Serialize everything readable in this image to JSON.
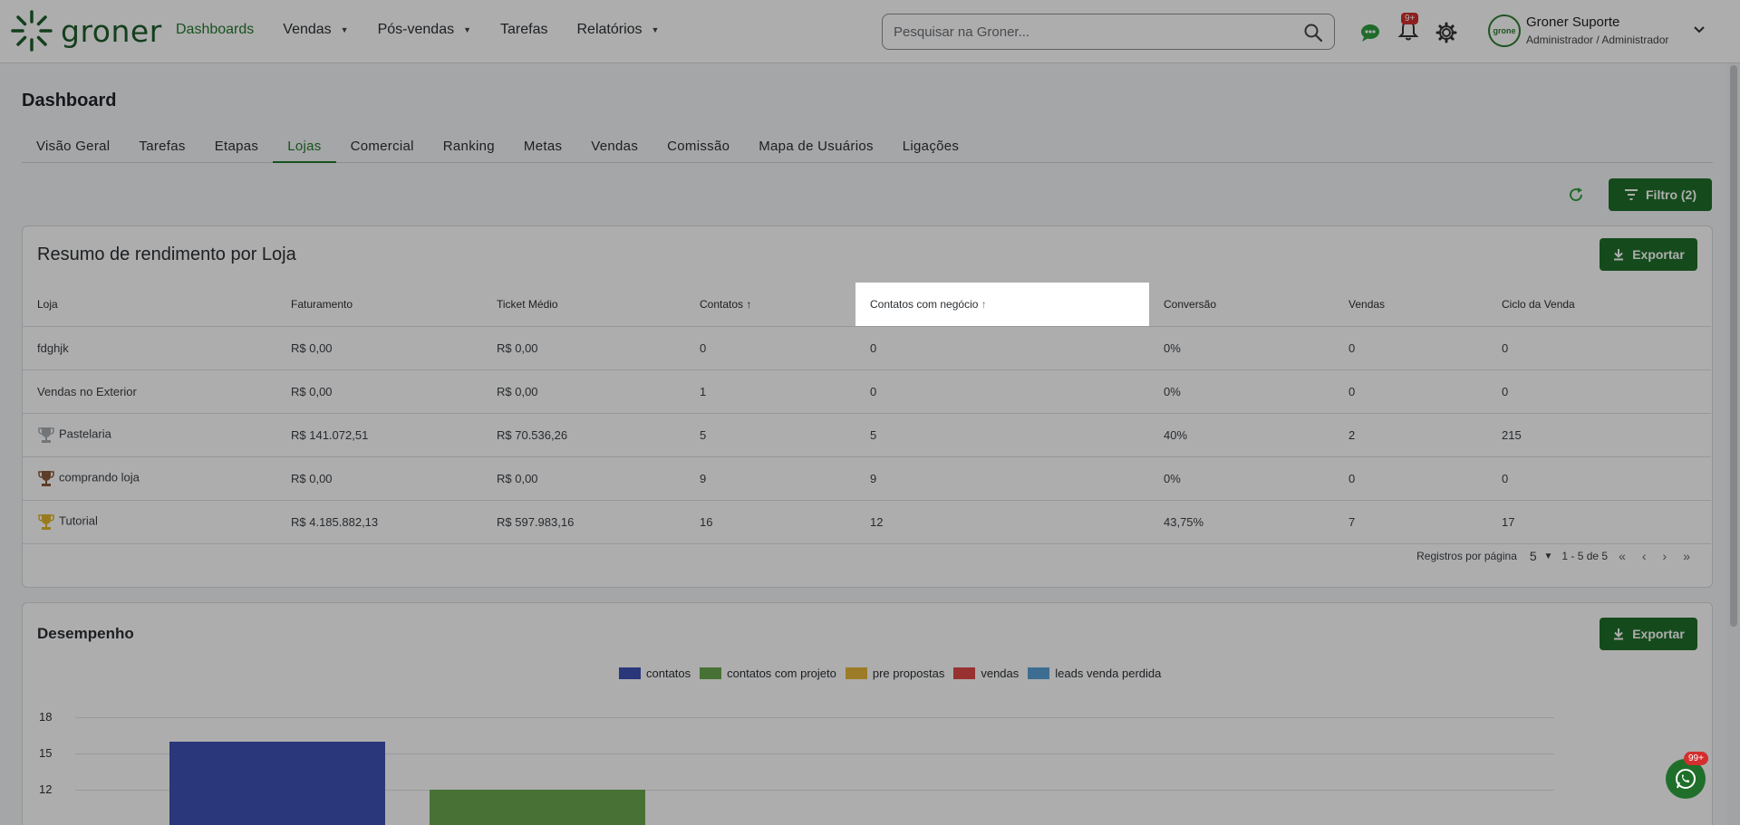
{
  "app": {
    "logo_text": "groner"
  },
  "nav": [
    {
      "label": "Dashboards",
      "active": true,
      "dropdown": false
    },
    {
      "label": "Vendas",
      "active": false,
      "dropdown": true
    },
    {
      "label": "Pós-vendas",
      "active": false,
      "dropdown": true
    },
    {
      "label": "Tarefas",
      "active": false,
      "dropdown": false
    },
    {
      "label": "Relatórios",
      "active": false,
      "dropdown": true
    }
  ],
  "search": {
    "placeholder": "Pesquisar na Groner..."
  },
  "notifications": {
    "badge": "9+"
  },
  "user": {
    "name": "Groner Suporte",
    "role": "Administrador / Administrador",
    "avatar_text": "grone"
  },
  "page": {
    "title": "Dashboard"
  },
  "tabs": [
    {
      "label": "Visão Geral",
      "active": false
    },
    {
      "label": "Tarefas",
      "active": false
    },
    {
      "label": "Etapas",
      "active": false
    },
    {
      "label": "Lojas",
      "active": true
    },
    {
      "label": "Comercial",
      "active": false
    },
    {
      "label": "Ranking",
      "active": false
    },
    {
      "label": "Metas",
      "active": false
    },
    {
      "label": "Vendas",
      "active": false
    },
    {
      "label": "Comissão",
      "active": false
    },
    {
      "label": "Mapa de Usuários",
      "active": false
    },
    {
      "label": "Ligações",
      "active": false
    }
  ],
  "filter_button": {
    "label": "Filtro (2)"
  },
  "summary_card": {
    "title": "Resumo de rendimento por Loja",
    "export_label": "Exportar",
    "columns": [
      "Loja",
      "Faturamento",
      "Ticket Médio",
      "Contatos",
      "Contatos com negócio",
      "Conversão",
      "Vendas",
      "Ciclo da Venda"
    ],
    "rows": [
      {
        "loja": "fdghjk",
        "trophy": "none",
        "faturamento": "R$ 0,00",
        "ticket": "R$ 0,00",
        "contatos": "0",
        "contatos_negocio": "0",
        "conversao": "0%",
        "vendas": "0",
        "ciclo": "0"
      },
      {
        "loja": "Vendas no Exterior",
        "trophy": "none",
        "faturamento": "R$ 0,00",
        "ticket": "R$ 0,00",
        "contatos": "1",
        "contatos_negocio": "0",
        "conversao": "0%",
        "vendas": "0",
        "ciclo": "0"
      },
      {
        "loja": "Pastelaria",
        "trophy": "silver",
        "faturamento": "R$ 141.072,51",
        "ticket": "R$ 70.536,26",
        "contatos": "5",
        "contatos_negocio": "5",
        "conversao": "40%",
        "vendas": "2",
        "ciclo": "215"
      },
      {
        "loja": "comprando loja",
        "trophy": "bronze",
        "faturamento": "R$ 0,00",
        "ticket": "R$ 0,00",
        "contatos": "9",
        "contatos_negocio": "9",
        "conversao": "0%",
        "vendas": "0",
        "ciclo": "0"
      },
      {
        "loja": "Tutorial",
        "trophy": "gold",
        "faturamento": "R$ 4.185.882,13",
        "ticket": "R$ 597.983,16",
        "contatos": "16",
        "contatos_negocio": "12",
        "conversao": "43,75%",
        "vendas": "7",
        "ciclo": "17"
      }
    ],
    "pagination": {
      "label": "Registros por página",
      "per_page": "5",
      "range": "1 - 5 de 5"
    }
  },
  "performance_card": {
    "title": "Desempenho",
    "export_label": "Exportar"
  },
  "chart_data": {
    "type": "bar",
    "series": [
      {
        "name": "contatos",
        "color": "#3f51b5",
        "value": 16
      },
      {
        "name": "contatos com projeto",
        "color": "#6aa84f",
        "value": 12
      },
      {
        "name": "pre propostas",
        "color": "#e6b73b",
        "value": null
      },
      {
        "name": "vendas",
        "color": "#e04b4b",
        "value": null
      },
      {
        "name": "leads venda perdida",
        "color": "#5aa3d6",
        "value": null
      }
    ],
    "yticks": [
      "18",
      "15",
      "12"
    ],
    "ylim_visible": [
      12,
      18
    ],
    "legend_position": "top-center",
    "grid": true
  },
  "whatsapp": {
    "badge": "99+"
  },
  "colors": {
    "brand": "#237a2f",
    "button": "#1f6f2a",
    "highlight": "#3ed39a"
  }
}
